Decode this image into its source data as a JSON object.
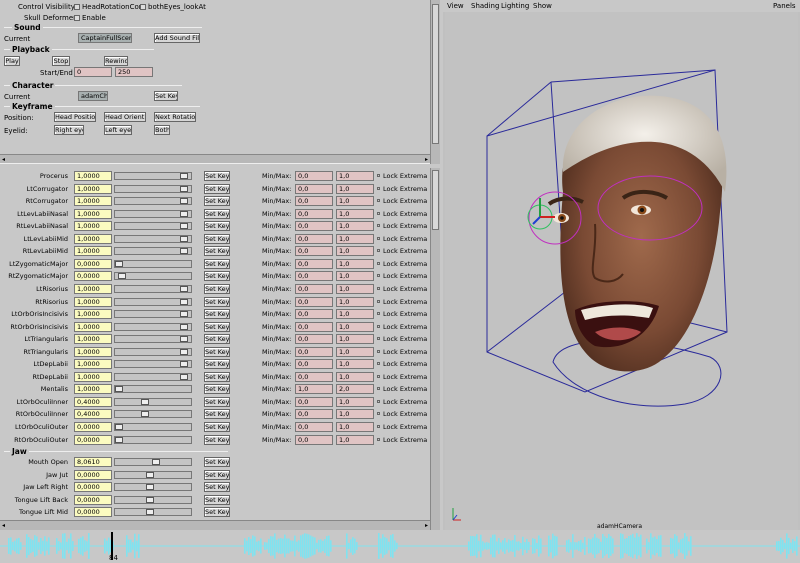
{
  "top": {
    "control_visibility_label": "Control Visibility:",
    "opt_head_rotation": "HeadRotationCon",
    "opt_both_eyes": "bothEyes_lookAt",
    "skull_deformer_label": "Skull Deformer:",
    "enable_label": "Enable",
    "sound": {
      "title": "Sound",
      "current_label": "Current",
      "current_value": "CaptainFullScene",
      "add_button": "Add Sound File"
    },
    "playback": {
      "title": "Playback",
      "play": "Play",
      "stop": "Stop",
      "rewind": "Rewind",
      "start_end_label": "Start/End",
      "start": "0",
      "end": "250"
    },
    "character": {
      "title": "Character",
      "current_label": "Current",
      "current_value": "adamChar",
      "set_key": "Set Key"
    },
    "keyframe": {
      "title": "Keyframe",
      "position_label": "Position:",
      "head_position": "Head Position",
      "head_orient": "Head Orient..",
      "next_rotation": "Next Rotation",
      "eyelid_label": "Eyelid:",
      "right_eye": "Right eye",
      "left_eye": "Left eye",
      "both": "Both"
    }
  },
  "labels": {
    "set_key": "Set Key",
    "min_max": "Min/Max:",
    "lock": "Lock Extrema"
  },
  "muscles": [
    {
      "name": "Procerus",
      "value": "1,0000",
      "min": "0,0",
      "max": "1,0",
      "level": 0.95
    },
    {
      "name": "LtCorrugator",
      "value": "1,0000",
      "min": "0,0",
      "max": "1,0",
      "level": 0.95
    },
    {
      "name": "RtCorrugator",
      "value": "1,0000",
      "min": "0,0",
      "max": "1,0",
      "level": 0.95
    },
    {
      "name": "LtLevLabiiNasal",
      "value": "1,0000",
      "min": "0,0",
      "max": "1,0",
      "level": 0.95
    },
    {
      "name": "RtLevLabiiNasal",
      "value": "1,0000",
      "min": "0,0",
      "max": "1,0",
      "level": 0.95
    },
    {
      "name": "LtLevLabiiMid",
      "value": "1,0000",
      "min": "0,0",
      "max": "1,0",
      "level": 0.95
    },
    {
      "name": "RtLevLabiiMid",
      "value": "1,0000",
      "min": "0,0",
      "max": "1,0",
      "level": 0.95
    },
    {
      "name": "LtZygomaticMajor",
      "value": "0,0000",
      "min": "0,0",
      "max": "1,0",
      "level": 0.0
    },
    {
      "name": "RtZygomaticMajor",
      "value": "0,0000",
      "min": "0,0",
      "max": "1,0",
      "level": 0.05
    },
    {
      "name": "LtRisorius",
      "value": "1,0000",
      "min": "0,0",
      "max": "1,0",
      "level": 0.95
    },
    {
      "name": "RtRisorius",
      "value": "1,0000",
      "min": "0,0",
      "max": "1,0",
      "level": 0.95
    },
    {
      "name": "LtOrbOrisIncisivis",
      "value": "1,0000",
      "min": "0,0",
      "max": "1,0",
      "level": 0.95
    },
    {
      "name": "RtOrbOrisIncisivis",
      "value": "1,0000",
      "min": "0,0",
      "max": "1,0",
      "level": 0.95
    },
    {
      "name": "LtTriangularis",
      "value": "1,0000",
      "min": "0,0",
      "max": "1,0",
      "level": 0.95
    },
    {
      "name": "RtTriangularis",
      "value": "1,0000",
      "min": "0,0",
      "max": "1,0",
      "level": 0.95
    },
    {
      "name": "LtDepLabii",
      "value": "1,0000",
      "min": "0,0",
      "max": "1,0",
      "level": 0.95
    },
    {
      "name": "RtDepLabii",
      "value": "1,0000",
      "min": "0,0",
      "max": "1,0",
      "level": 0.95
    },
    {
      "name": "Mentalis",
      "value": "1,0000",
      "min": "1,0",
      "max": "2,0",
      "level": 0.0
    },
    {
      "name": "LtOrbOculiInner",
      "value": "0,4000",
      "min": "0,0",
      "max": "1,0",
      "level": 0.38
    },
    {
      "name": "RtOrbOculiInner",
      "value": "0,4000",
      "min": "0,0",
      "max": "1,0",
      "level": 0.38
    },
    {
      "name": "LtOrbOculiOuter",
      "value": "0,0000",
      "min": "0,0",
      "max": "1,0",
      "level": 0.0
    },
    {
      "name": "RtOrbOculiOuter",
      "value": "0,0000",
      "min": "0,0",
      "max": "1,0",
      "level": 0.0
    }
  ],
  "jaw": {
    "title": "Jaw",
    "rows": [
      {
        "name": "Mouth Open",
        "value": "8,0610",
        "level": 0.55
      },
      {
        "name": "Jaw Jut",
        "value": "0,0000",
        "level": 0.45
      },
      {
        "name": "Jaw Left Right",
        "value": "0,0000",
        "level": 0.45
      },
      {
        "name": "Tongue Lift Back",
        "value": "0,0000",
        "level": 0.45
      },
      {
        "name": "Tongue Lift Mid",
        "value": "0,0000",
        "level": 0.45
      }
    ]
  },
  "viewport": {
    "menu": [
      "View",
      "Shading",
      "Lighting",
      "Show"
    ],
    "panels": "Panels",
    "camera_label": "adamHCamera",
    "accent_blue": "#2a2a9a",
    "accent_magenta": "#c030c0"
  },
  "timeline": {
    "current_frame": "84",
    "wave_color": "#7fe3f0"
  }
}
